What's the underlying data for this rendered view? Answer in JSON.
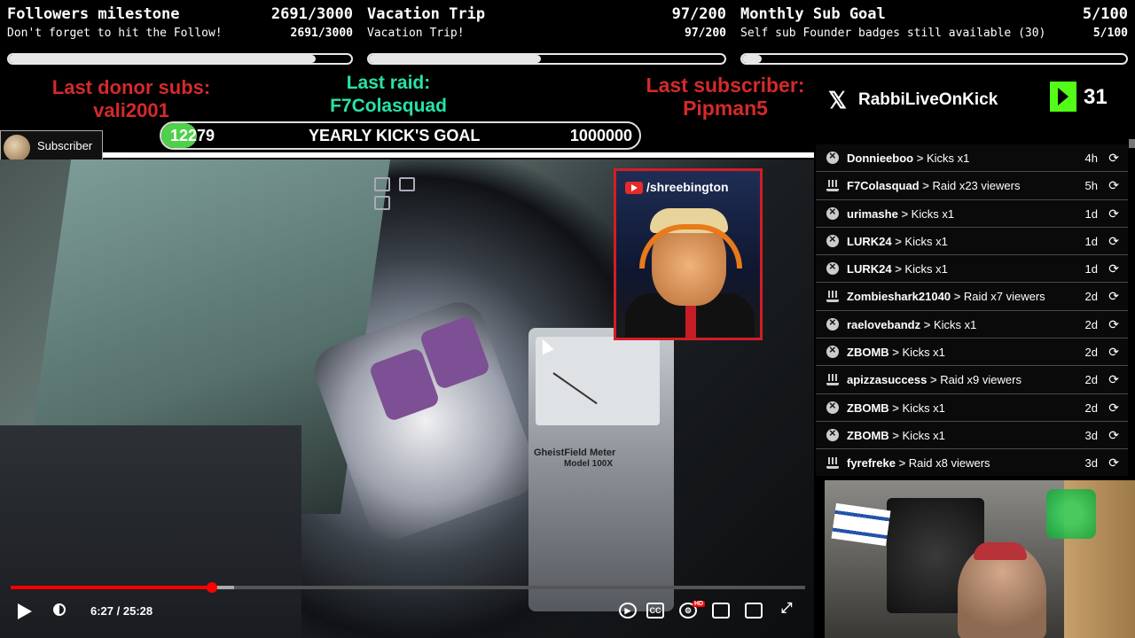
{
  "goals": [
    {
      "title": "Followers milestone",
      "title_value": "2691/3000",
      "subtitle": "Don't forget to hit the Follow!",
      "subtitle_value": "2691/3000",
      "progress": 0.897
    },
    {
      "title": "Vacation Trip",
      "title_value": "97/200",
      "subtitle": "Vacation Trip!",
      "subtitle_value": "97/200",
      "progress": 0.485
    },
    {
      "title": "Monthly Sub Goal",
      "title_value": "5/100",
      "subtitle": "Self sub Founder badges still available (30)",
      "subtitle_value": "5/100",
      "progress": 0.05
    }
  ],
  "last_donor": {
    "label": "Last donor subs:",
    "name": "vali2001"
  },
  "last_raid": {
    "label": "Last raid:",
    "name": "F7Colasquad"
  },
  "last_subscriber": {
    "label": "Last subscriber:",
    "name": "Pipman5"
  },
  "yearly_goal": {
    "current": "12279",
    "label": "YEARLY KICK'S GOAL",
    "target": "1000000",
    "progress": 0.0123
  },
  "sub_badge": {
    "label": "Subscriber"
  },
  "social": {
    "x_handle": "RabbiLiveOnKick",
    "kick_count": "31"
  },
  "events": [
    {
      "type": "kick",
      "user": "Donnieeboo",
      "action": "Kicks x1",
      "ago": "4h"
    },
    {
      "type": "raid",
      "user": "F7Colasquad",
      "action": "Raid x23 viewers",
      "ago": "5h"
    },
    {
      "type": "kick",
      "user": "urimashe",
      "action": "Kicks x1",
      "ago": "1d"
    },
    {
      "type": "kick",
      "user": "LURK24",
      "action": "Kicks x1",
      "ago": "1d"
    },
    {
      "type": "kick",
      "user": "LURK24",
      "action": "Kicks x1",
      "ago": "1d"
    },
    {
      "type": "raid",
      "user": "Zombieshark21040",
      "action": "Raid x7 viewers",
      "ago": "2d"
    },
    {
      "type": "kick",
      "user": "raelovebandz",
      "action": "Kicks x1",
      "ago": "2d"
    },
    {
      "type": "kick",
      "user": "ZBOMB",
      "action": "Kicks x1",
      "ago": "2d"
    },
    {
      "type": "raid",
      "user": "apizzasuccess",
      "action": "Raid x9 viewers",
      "ago": "2d"
    },
    {
      "type": "kick",
      "user": "ZBOMB",
      "action": "Kicks x1",
      "ago": "2d"
    },
    {
      "type": "kick",
      "user": "ZBOMB",
      "action": "Kicks x1",
      "ago": "3d"
    },
    {
      "type": "raid",
      "user": "fyrefreke",
      "action": "Raid x8 viewers",
      "ago": "3d"
    }
  ],
  "event_separator": ">",
  "pip": {
    "handle": "/shreebington"
  },
  "player": {
    "time": "6:27 / 25:28",
    "progress": 0.253,
    "buffered": 0.281,
    "hd_badge": "HD"
  },
  "meter": {
    "line1": "GheistField Meter",
    "line2": "Model 100X"
  },
  "colors": {
    "red_label": "#d42a2a",
    "teal_label": "#27e3a8",
    "kick_green": "#53fc18",
    "yt_red": "#ff0000"
  },
  "icons": [
    "x-logo-icon",
    "kick-logo-icon",
    "kick-event-icon",
    "raid-event-icon",
    "replay-icon",
    "play-icon",
    "volume-icon",
    "autoplay-icon",
    "captions-icon",
    "settings-icon",
    "theater-icon",
    "cast-icon",
    "fullscreen-icon"
  ]
}
